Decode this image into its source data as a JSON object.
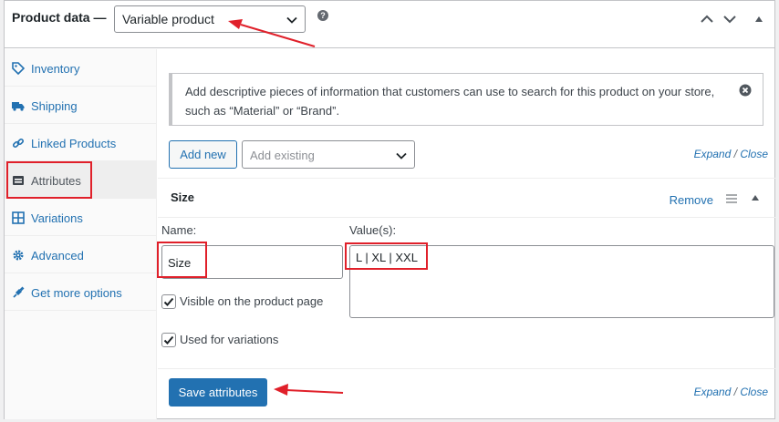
{
  "header": {
    "title": "Product data —",
    "product_type": "Variable product",
    "help": "?"
  },
  "sidebar": {
    "items": [
      {
        "label": "Inventory",
        "icon": "tag-icon"
      },
      {
        "label": "Shipping",
        "icon": "truck-icon"
      },
      {
        "label": "Linked Products",
        "icon": "link-icon"
      },
      {
        "label": "Attributes",
        "icon": "list-icon",
        "active": true
      },
      {
        "label": "Variations",
        "icon": "grid-icon"
      },
      {
        "label": "Advanced",
        "icon": "gear-icon"
      },
      {
        "label": "Get more options",
        "icon": "plug-icon"
      }
    ]
  },
  "notice": {
    "text": "Add descriptive pieces of information that customers can use to search for this product on your store, such as “Material” or “Brand”."
  },
  "toolbar": {
    "add_new": "Add new",
    "add_existing_placeholder": "Add existing",
    "expand": "Expand",
    "separator": "/",
    "close": "Close"
  },
  "attribute": {
    "title": "Size",
    "remove": "Remove",
    "name_label": "Name:",
    "name_value": "Size",
    "values_label": "Value(s):",
    "values_value": "L | XL | XXL",
    "visible_label": "Visible on the product page",
    "visible_checked": true,
    "variations_label": "Used for variations",
    "variations_checked": true
  },
  "footer": {
    "save": "Save attributes",
    "expand": "Expand",
    "separator": "/",
    "close": "Close"
  },
  "colors": {
    "accent": "#2271b1",
    "annotation": "#e0202a"
  }
}
